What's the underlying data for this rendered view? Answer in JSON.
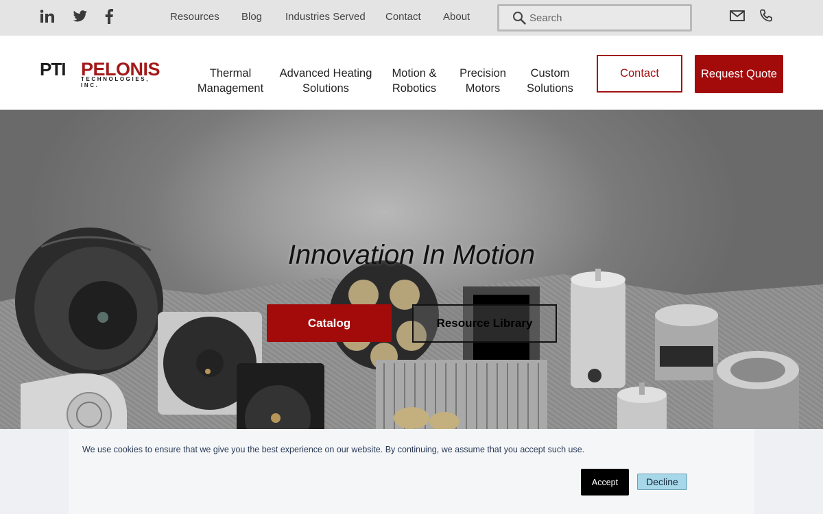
{
  "topbar": {
    "social": [
      {
        "name": "linkedin-icon",
        "glyph": "in"
      },
      {
        "name": "twitter-icon"
      },
      {
        "name": "facebook-icon",
        "glyph": "f"
      }
    ],
    "links": [
      "Resources",
      "Blog",
      "Industries Served",
      "Contact",
      "About"
    ],
    "search": {
      "placeholder": "Search",
      "value": ""
    },
    "icons": [
      "mail-icon",
      "phone-icon"
    ]
  },
  "header": {
    "logo": {
      "mark": "PTI",
      "name": "PELONIS",
      "sub": "TECHNOLOGIES, INC."
    },
    "nav": [
      {
        "line1": "Thermal",
        "line2": "Management"
      },
      {
        "line1": "Advanced Heating",
        "line2": "Solutions"
      },
      {
        "line1": "Motion &",
        "line2": "Robotics"
      },
      {
        "line1": "Precision",
        "line2": "Motors"
      },
      {
        "line1": "Custom",
        "line2": "Solutions"
      }
    ],
    "contact_label": "Contact",
    "quote_label": "Request Quote"
  },
  "hero": {
    "title": "Innovation In Motion",
    "catalog_label": "Catalog",
    "library_label": "Resource Library"
  },
  "cookie": {
    "text": "We use cookies to ensure that we give you the best experience on our website. By continuing, we assume that you accept such use.",
    "accept_label": "Accept",
    "decline_label": "Decline"
  },
  "colors": {
    "brand_red": "#a30a0a",
    "topbar_bg": "#e4e4e4",
    "decline_bg": "#a7d8ea"
  }
}
